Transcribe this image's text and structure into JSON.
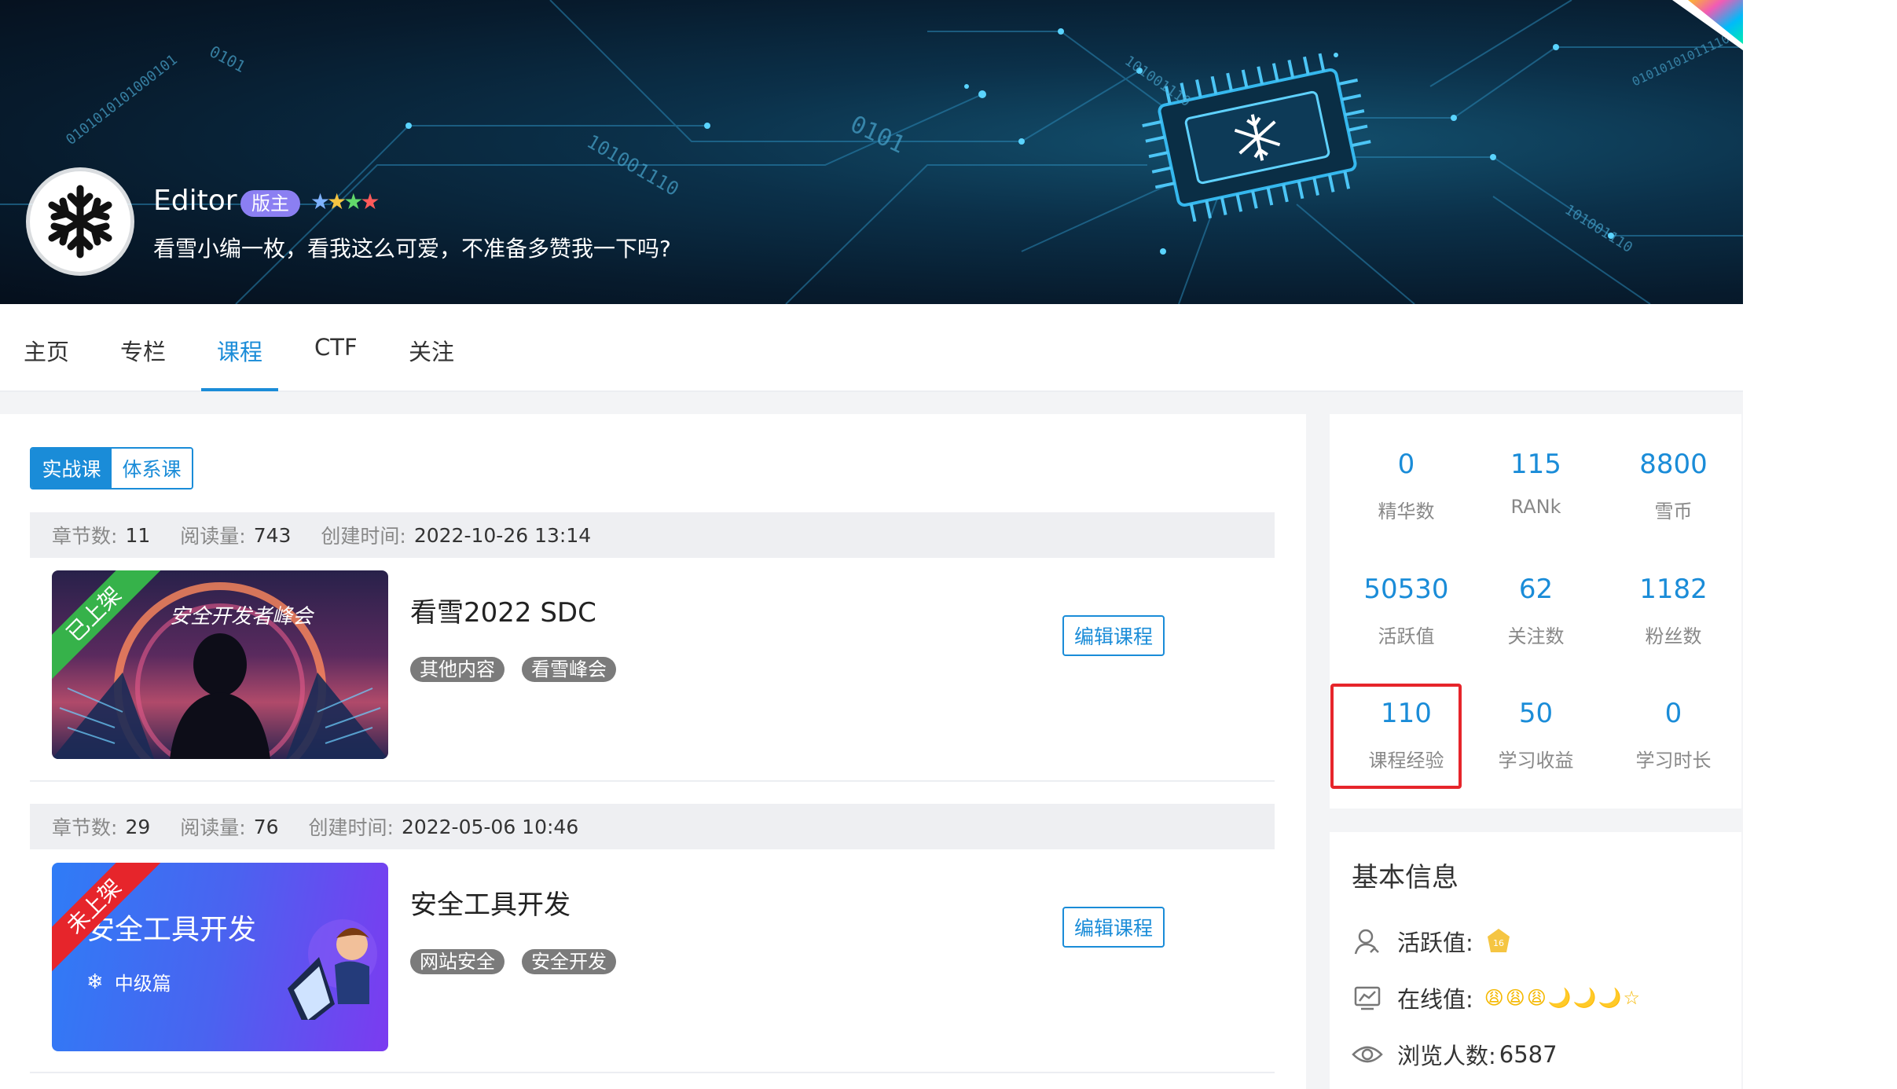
{
  "profile": {
    "name": "Editor",
    "role_badge": "版主",
    "stars": "★★★★",
    "bio": "看雪小编一枚，看我这么可爱，不准备多赞我一下吗?",
    "banner_binary_texts": [
      "0101",
      "0101010101000101",
      "101001110",
      "0101",
      "101001110",
      "01010101011110",
      "101001110"
    ]
  },
  "tabs": [
    {
      "label": "主页"
    },
    {
      "label": "专栏"
    },
    {
      "label": "课程",
      "active": true
    },
    {
      "label": "CTF"
    },
    {
      "label": "关注"
    }
  ],
  "course_filter": {
    "options": [
      "实战课",
      "体系课"
    ],
    "selected": "实战课"
  },
  "course_meta_labels": {
    "chapters": "章节数:",
    "reads": "阅读量:",
    "created": "创建时间:"
  },
  "courses": [
    {
      "chapters": "11",
      "reads": "743",
      "created": "2022-10-26 13:14",
      "status": "已上架",
      "status_color": "#36b24a",
      "title": "看雪2022 SDC",
      "tags": [
        "其他内容",
        "看雪峰会"
      ],
      "edit_label": "编辑课程",
      "thumb_caption_small": "安全开发者峰会"
    },
    {
      "chapters": "29",
      "reads": "76",
      "created": "2022-05-06 10:46",
      "status": "未上架",
      "status_color": "#e6252b",
      "title": "安全工具开发",
      "tags": [
        "网站安全",
        "安全开发"
      ],
      "edit_label": "编辑课程",
      "thumb_title": "安全工具开发",
      "thumb_level": "中级篇"
    }
  ],
  "stats": [
    {
      "value": "0",
      "label": "精华数"
    },
    {
      "value": "115",
      "label": "RANk"
    },
    {
      "value": "8800",
      "label": "雪币"
    },
    {
      "value": "50530",
      "label": "活跃值"
    },
    {
      "value": "62",
      "label": "关注数"
    },
    {
      "value": "1182",
      "label": "粉丝数"
    },
    {
      "value": "110",
      "label": "课程经验",
      "highlighted": true
    },
    {
      "value": "50",
      "label": "学习收益"
    },
    {
      "value": "0",
      "label": "学习时长"
    }
  ],
  "basic_info": {
    "title": "基本信息",
    "active_label": "活跃值:",
    "active_badge_level": "16",
    "online_label": "在线值:",
    "online_icons": "😩😩😩🌙🌙🌙☆",
    "views_label": "浏览人数:",
    "views_value": "6587"
  },
  "colors": {
    "accent": "#1a8cd8",
    "highlight_border": "#e6252b",
    "tag_bg": "#7b7b7b",
    "badge": "#8b7ff2"
  }
}
